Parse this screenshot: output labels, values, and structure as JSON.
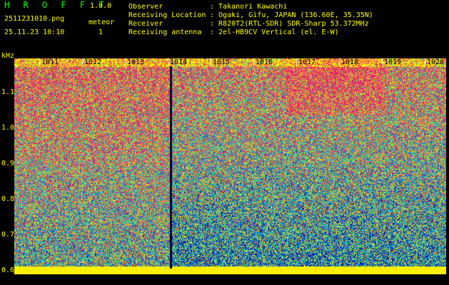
{
  "app": {
    "name": "H R O F F T",
    "version": "1.0.0"
  },
  "file": {
    "name": "2511231010.png",
    "datetime": "25.11.23 10:10"
  },
  "meteor": {
    "label": "meteor",
    "count": "1"
  },
  "info": [
    {
      "key": "Observer",
      "value": ": Takanori Kawachi"
    },
    {
      "key": "Receiving Location",
      "value": ": Ogaki, Gifu, JAPAN (136.60E, 35.35N)"
    },
    {
      "key": "Receiver",
      "value": ": R820T2(RTL-SDR) SDR-Sharp 53.372MHz"
    },
    {
      "key": "Receiving antenna",
      "value": ": 2el-HB9CV Vertical (el. E-W)"
    }
  ],
  "axis": {
    "unit": "kHz",
    "y_ticks": [
      "1.1",
      "1.0",
      "0.9",
      "0.8",
      "0.7",
      "0.6"
    ],
    "x_ticks": [
      "1011",
      "1012",
      "1013",
      "1014",
      "1015",
      "1016",
      "1017",
      "1018",
      "1019",
      "1020"
    ]
  },
  "colors": {
    "text": "#ffff00",
    "title": "#00ff00",
    "bg": "#000000",
    "floor": "#ffff00"
  }
}
